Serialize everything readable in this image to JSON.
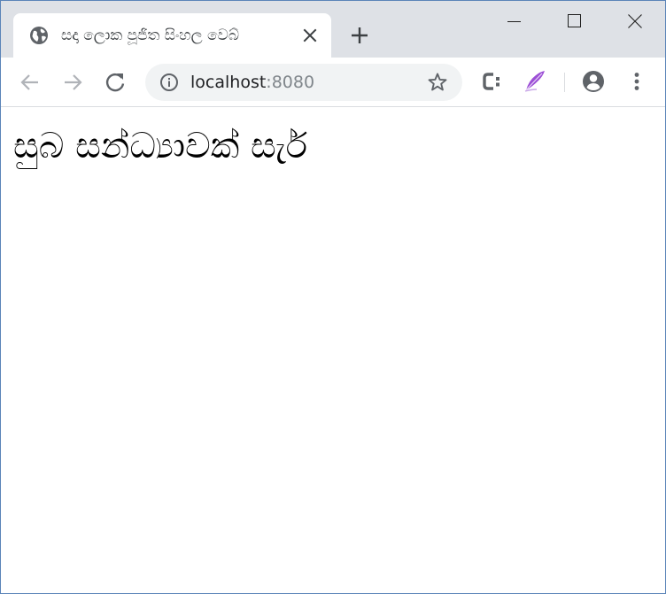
{
  "browser": {
    "tab": {
      "title": "සදා ලොක පූජිත සිංහල වෙබ්",
      "favicon": "globe-icon"
    },
    "controls": {
      "new_tab_icon": "plus-icon",
      "minimize_icon": "minimize-icon",
      "maximize_icon": "maximize-icon",
      "close_icon": "close-icon"
    },
    "address_bar": {
      "host": "localhost",
      "port": ":8080",
      "security_icon": "info-icon",
      "bookmark_icon": "star-icon"
    },
    "extensions": [
      "c-extension-icon",
      "quill-extension-icon"
    ],
    "profile_icon": "account-circle-icon",
    "menu_icon": "kebab-menu-icon"
  },
  "page": {
    "heading": "සුබ සන්ධ්‍යාවක් සැර්"
  },
  "colors": {
    "tabstrip": "#dee1e6",
    "omnibox": "#f1f3f4",
    "icon_active": "#5f6368",
    "icon_disabled": "#b0b3b8",
    "quill_purple": "#9c4fd6"
  }
}
